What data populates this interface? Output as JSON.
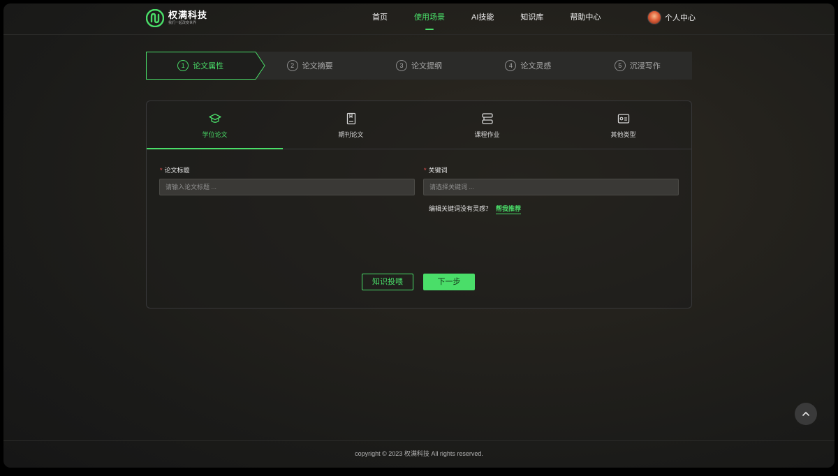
{
  "brand": {
    "name": "权满科技",
    "slogan": "我们一起改变世界"
  },
  "nav": {
    "items": [
      {
        "label": "首页"
      },
      {
        "label": "使用场景"
      },
      {
        "label": "AI技能"
      },
      {
        "label": "知识库"
      },
      {
        "label": "帮助中心"
      }
    ],
    "active_index": 1
  },
  "user": {
    "label": "个人中心"
  },
  "steps": [
    {
      "num": "1",
      "label": "论文属性"
    },
    {
      "num": "2",
      "label": "论文摘要"
    },
    {
      "num": "3",
      "label": "论文提纲"
    },
    {
      "num": "4",
      "label": "论文灵感"
    },
    {
      "num": "5",
      "label": "沉浸写作"
    }
  ],
  "active_step": 0,
  "tabs": [
    {
      "label": "学位论文",
      "icon": "graduation-cap-icon"
    },
    {
      "label": "期刊论文",
      "icon": "journal-book-icon"
    },
    {
      "label": "课程作业",
      "icon": "stacked-books-icon"
    },
    {
      "label": "其他类型",
      "icon": "id-card-icon"
    }
  ],
  "active_tab": 0,
  "form": {
    "title_label": "论文标题",
    "title_placeholder": "请输入论文标题 ...",
    "keyword_label": "关键词",
    "keyword_placeholder": "请选择关键词 ...",
    "required_mark": "*",
    "hint_text": "编辑关键词没有灵感？",
    "hint_link": "帮我推荐"
  },
  "buttons": {
    "knowledge": "知识投喂",
    "next": "下一步"
  },
  "footer": {
    "copyright": "copyright © 2023 权满科技 All rights reserved."
  },
  "colors": {
    "accent": "#4ade69",
    "required": "#f05454",
    "background": "#1e1d1b"
  }
}
